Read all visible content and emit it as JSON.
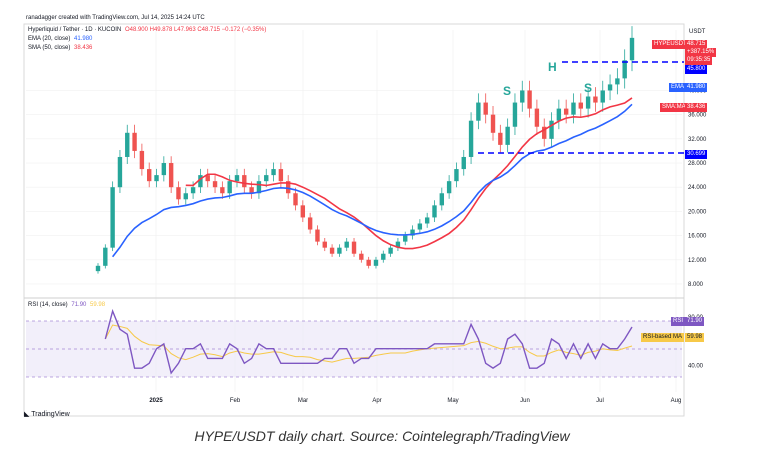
{
  "header": {
    "created_by": "ranadagger created with TradingView.com, Jul 14, 2025 14:24 UTC",
    "currency": "USDT"
  },
  "legend": {
    "symbol": "Hyperliquid / Tether · 1D · KUCOIN",
    "ohlc": "O48.900  H49.878  L47.963  C48.715  −0.172 (−0.35%)",
    "ema_label": "EMA (20, close)",
    "ema_value": "41.980",
    "sma_label": "SMA (50, close)",
    "sma_value": "38.436",
    "rsi_label": "RSI (14, close)",
    "rsi_value": "71.90",
    "rsi_extra": "59.98"
  },
  "price_tags": {
    "symbol": "HYPEUSDT",
    "price": "48.715",
    "change": "+387.15%",
    "countdown": "09:35:35",
    "resistance": "45.800",
    "ema": "EMA",
    "ema_value": "41.980",
    "sma": "SMA:MA",
    "sma_value": "38.436",
    "support": "30.699",
    "rsi": "RSI",
    "rsi_value": "71.90",
    "rsi_ma": "RSI-based MA",
    "rsi_ma_value": "59.98"
  },
  "annotations": {
    "left_shoulder": "S",
    "head": "H",
    "right_shoulder": "S"
  },
  "caption": "HYPE/USDT daily chart. Source: Cointelegraph/TradingView",
  "footer": {
    "logo": "TradingView"
  },
  "chart_data": [
    {
      "type": "line",
      "title": "Hyperliquid / Tether · 1D · KUCOIN",
      "x_ticks": [
        "2025",
        "Feb",
        "Mar",
        "Apr",
        "May",
        "Jun",
        "Jul",
        "Aug"
      ],
      "y_ticks": [
        8.0,
        12.0,
        16.0,
        20.0,
        24.0,
        28.0,
        32.0,
        36.0,
        40.0
      ],
      "ylim": [
        7,
        50
      ],
      "grid": true,
      "series": [
        {
          "name": "close",
          "color": "#26a69a",
          "x": [
            0,
            1,
            2,
            3,
            4,
            5,
            6,
            7,
            8,
            9,
            10,
            11,
            12,
            13,
            14,
            15,
            16,
            17,
            18,
            19,
            20,
            21,
            22,
            23,
            24,
            25,
            26,
            27,
            28,
            29,
            30,
            31,
            32,
            33,
            34,
            35,
            36,
            37,
            38,
            39,
            40,
            41,
            42,
            43,
            44,
            45,
            46,
            47,
            48,
            49,
            50,
            51,
            52,
            53,
            54,
            55,
            56,
            57,
            58,
            59,
            60,
            61,
            62,
            63,
            64,
            65,
            66,
            67,
            68,
            69,
            70,
            71,
            72,
            73,
            74,
            75,
            76,
            77,
            78,
            79,
            80,
            81,
            82,
            83,
            84,
            85
          ],
          "values": [
            11,
            14,
            24,
            29,
            33,
            30,
            27,
            25,
            26,
            28,
            24,
            22,
            23,
            24,
            26,
            25,
            24,
            23,
            25,
            26,
            24,
            23,
            25,
            26,
            27,
            25,
            23,
            21,
            19,
            17,
            15,
            14,
            13,
            14,
            15,
            13,
            12,
            11,
            12,
            13,
            14,
            15,
            16,
            17,
            18,
            19,
            21,
            23,
            25,
            27,
            29,
            35,
            38,
            36,
            33,
            31,
            34,
            38,
            40,
            37,
            34,
            32,
            35,
            37,
            36,
            38,
            37,
            39,
            38,
            40,
            41,
            42,
            45,
            48.7,
            48.7,
            48.7,
            48.7,
            48.7,
            48.7,
            48.7,
            48.7,
            48.7,
            48.7,
            48.7,
            48.7,
            48.7
          ]
        },
        {
          "name": "EMA (20, close)",
          "color": "#2962ff",
          "value_last": 41.98
        },
        {
          "name": "SMA (50, close)",
          "color": "#f23645",
          "value_last": 38.436
        }
      ],
      "levels": [
        {
          "label": "45.800",
          "value": 45.8,
          "style": "dashed",
          "color": "#0000ff"
        },
        {
          "label": "30.699",
          "value": 30.699,
          "style": "dashed",
          "color": "#0000ff"
        }
      ]
    },
    {
      "type": "line",
      "title": "RSI (14, close)",
      "y_ticks": [
        40.0,
        80.0
      ],
      "ylim": [
        20,
        90
      ],
      "series": [
        {
          "name": "RSI (14, close)",
          "color": "#7e57c2",
          "value_last": 71.9
        },
        {
          "name": "RSI-based MA",
          "color": "#f7c948",
          "value_last": 59.98
        }
      ]
    }
  ]
}
